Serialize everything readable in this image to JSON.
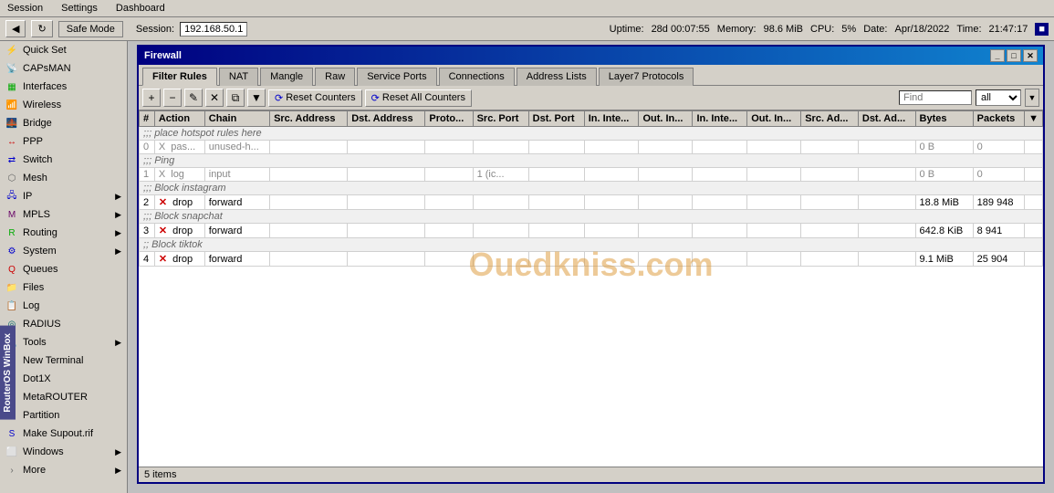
{
  "menu": {
    "items": [
      {
        "label": "Session"
      },
      {
        "label": "Settings"
      },
      {
        "label": "Dashboard"
      }
    ]
  },
  "toolbar": {
    "safe_mode_label": "Safe Mode",
    "session_label": "Session:",
    "session_ip": "192.168.50.1",
    "uptime_label": "Uptime:",
    "uptime_value": "28d 00:07:55",
    "memory_label": "Memory:",
    "memory_value": "98.6 MiB",
    "cpu_label": "CPU:",
    "cpu_value": "5%",
    "date_label": "Date:",
    "date_value": "Apr/18/2022",
    "time_label": "Time:",
    "time_value": "21:47:17"
  },
  "sidebar": {
    "items": [
      {
        "label": "Quick Set",
        "icon": "⚡",
        "color": "icon-green",
        "arrow": false
      },
      {
        "label": "CAPsMAN",
        "icon": "📡",
        "color": "icon-green",
        "arrow": false
      },
      {
        "label": "Interfaces",
        "icon": "🔌",
        "color": "icon-green",
        "arrow": false
      },
      {
        "label": "Wireless",
        "icon": "📶",
        "color": "icon-green",
        "arrow": false
      },
      {
        "label": "Bridge",
        "icon": "🌉",
        "color": "icon-orange",
        "arrow": false
      },
      {
        "label": "PPP",
        "icon": "↔",
        "color": "icon-red",
        "arrow": false
      },
      {
        "label": "Switch",
        "icon": "⇄",
        "color": "icon-blue",
        "arrow": false
      },
      {
        "label": "Mesh",
        "icon": "⬡",
        "color": "icon-gray",
        "arrow": false
      },
      {
        "label": "IP",
        "icon": "IP",
        "color": "icon-blue",
        "arrow": true
      },
      {
        "label": "MPLS",
        "icon": "M",
        "color": "icon-purple",
        "arrow": true
      },
      {
        "label": "Routing",
        "icon": "R",
        "color": "icon-green",
        "arrow": true
      },
      {
        "label": "System",
        "icon": "⚙",
        "color": "icon-blue",
        "arrow": true
      },
      {
        "label": "Queues",
        "icon": "Q",
        "color": "icon-red",
        "arrow": false
      },
      {
        "label": "Files",
        "icon": "📁",
        "color": "icon-orange",
        "arrow": false
      },
      {
        "label": "Log",
        "icon": "📋",
        "color": "icon-blue",
        "arrow": false
      },
      {
        "label": "RADIUS",
        "icon": "R",
        "color": "icon-teal",
        "arrow": false
      },
      {
        "label": "Tools",
        "icon": "🔧",
        "color": "icon-gray",
        "arrow": true
      },
      {
        "label": "New Terminal",
        "icon": "▶",
        "color": "icon-black",
        "arrow": false
      },
      {
        "label": "Dot1X",
        "icon": "D",
        "color": "icon-blue",
        "arrow": false
      },
      {
        "label": "MetaROUTER",
        "icon": "M",
        "color": "icon-green",
        "arrow": false
      },
      {
        "label": "Partition",
        "icon": "P",
        "color": "icon-orange",
        "arrow": false
      },
      {
        "label": "Make Supout.rif",
        "icon": "S",
        "color": "icon-blue",
        "arrow": false
      },
      {
        "label": "Windows",
        "icon": "W",
        "color": "icon-gray",
        "arrow": true
      },
      {
        "label": "More",
        "icon": ">",
        "color": "icon-gray",
        "arrow": true
      }
    ],
    "winbox_label": "RouterOS WinBox"
  },
  "firewall": {
    "title": "Firewall",
    "tabs": [
      {
        "label": "Filter Rules",
        "active": true
      },
      {
        "label": "NAT"
      },
      {
        "label": "Mangle"
      },
      {
        "label": "Raw"
      },
      {
        "label": "Service Ports"
      },
      {
        "label": "Connections"
      },
      {
        "label": "Address Lists"
      },
      {
        "label": "Layer7 Protocols"
      }
    ],
    "toolbar": {
      "reset_counters1": "Reset Counters",
      "reset_counters2": "Reset All Counters",
      "find_placeholder": "Find",
      "find_option": "all"
    },
    "table": {
      "headers": [
        "#",
        "Action",
        "Chain",
        "Src. Address",
        "Dst. Address",
        "Proto...",
        "Src. Port",
        "Dst. Port",
        "In. Inte...",
        "Out. In...",
        "In. Inte...",
        "Out. In...",
        "Src. Ad...",
        "Dst. Ad...",
        "Bytes",
        "Packets"
      ],
      "rows": [
        {
          "type": "comment",
          "comment": ";;; place hotspot rules here"
        },
        {
          "type": "data",
          "num": "0",
          "disabled": true,
          "action_icon": "X",
          "action": "pas...",
          "chain": "unused-h...",
          "src_address": "",
          "dst_address": "",
          "proto": "",
          "src_port": "",
          "dst_port": "",
          "in_int1": "",
          "out_in1": "",
          "in_int2": "",
          "out_in2": "",
          "src_ad": "",
          "dst_ad": "",
          "bytes": "0 B",
          "packets": "0"
        },
        {
          "type": "comment",
          "comment": ";;; Ping"
        },
        {
          "type": "data",
          "num": "1",
          "disabled": true,
          "action_icon": "X",
          "action": "log",
          "chain": "input",
          "src_address": "",
          "dst_address": "",
          "proto": "",
          "src_port": "1 (ic...",
          "dst_port": "",
          "in_int1": "",
          "out_in1": "",
          "in_int2": "",
          "out_in2": "",
          "src_ad": "",
          "dst_ad": "",
          "bytes": "0 B",
          "packets": "0"
        },
        {
          "type": "comment",
          "comment": ";;; Block instagram"
        },
        {
          "type": "data",
          "num": "2",
          "disabled": false,
          "action_icon": "drop_x",
          "action": "drop",
          "chain": "forward",
          "src_address": "",
          "dst_address": "",
          "proto": "",
          "src_port": "",
          "dst_port": "",
          "in_int1": "",
          "out_in1": "",
          "in_int2": "",
          "out_in2": "",
          "src_ad": "",
          "dst_ad": "",
          "bytes": "18.8 MiB",
          "packets": "189 948"
        },
        {
          "type": "comment",
          "comment": ";;; Block snapchat"
        },
        {
          "type": "data",
          "num": "3",
          "disabled": false,
          "action_icon": "drop_x",
          "action": "drop",
          "chain": "forward",
          "src_address": "",
          "dst_address": "",
          "proto": "",
          "src_port": "",
          "dst_port": "",
          "in_int1": "",
          "out_in1": "",
          "in_int2": "",
          "out_in2": "",
          "src_ad": "",
          "dst_ad": "",
          "bytes": "642.8 KiB",
          "packets": "8 941"
        },
        {
          "type": "comment",
          "comment": ";; Block tiktok"
        },
        {
          "type": "data",
          "num": "4",
          "disabled": false,
          "action_icon": "drop_x",
          "action": "drop",
          "chain": "forward",
          "src_address": "",
          "dst_address": "",
          "proto": "",
          "src_port": "",
          "dst_port": "",
          "in_int1": "",
          "out_in1": "",
          "in_int2": "",
          "out_in2": "",
          "src_ad": "",
          "dst_ad": "",
          "bytes": "9.1 MiB",
          "packets": "25 904"
        }
      ]
    },
    "status": "5 items"
  },
  "watermark": "Ouedkniss.com"
}
